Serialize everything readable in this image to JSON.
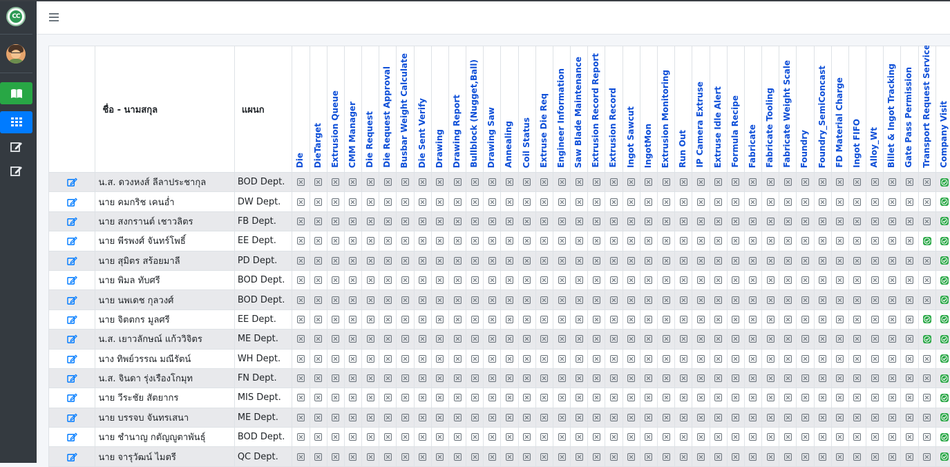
{
  "sidebar": {
    "logo_text": "CC",
    "icons": [
      "logo-icon",
      "user-avatar",
      "book-icon",
      "grid-icon",
      "edit-icon",
      "edit-icon"
    ],
    "accent_green": "#28a745",
    "accent_blue": "#007bff",
    "bg": "#343a40"
  },
  "header": {
    "menu_icon": "hamburger-icon"
  },
  "table": {
    "col_name": "ชื่อ - นามสกุล",
    "col_dept": "แผนก",
    "permission_columns": [
      "Die",
      "DieTarget",
      "Extrusion Queue",
      "CMM Manager",
      "Die Request",
      "Die Request Approval",
      "Busbar Weight Calculate",
      "Die Sent Verify",
      "Drawing",
      "Drawing Report",
      "Bullblock (Nugget,Ball)",
      "Drawing Saw",
      "Annealing",
      "Coil Status",
      "Extruse Die Req",
      "Engineer Information",
      "Saw Blade Maintenance",
      "Extrusion Record Report",
      "Extrusion Record",
      "Ingot Sawcut",
      "IngotMon",
      "Extrusion Monitoring",
      "Run Out",
      "IP Camera Extruse",
      "Extruse Idle Alert",
      "Formula Recipe",
      "Fabricate",
      "Fabricate Tooling",
      "Fabricate Weight Scale",
      "Foundry",
      "Foundry_SemiConcast",
      "FD Material Charge",
      "Ingot FIFO",
      "Alloy_Wt",
      "Billet & Ingot Tracking",
      "Gate Pass Permission",
      "Transport Request Service",
      "Company Visit"
    ],
    "rows": [
      {
        "name": "น.ส. ดวงหงส์   ลีลาประชากุล",
        "dept": "BOD Dept.",
        "granted": [
          37
        ]
      },
      {
        "name": "นาย คมกริช   เคนอ่ำ",
        "dept": "DW Dept.",
        "granted": [
          37
        ]
      },
      {
        "name": "นาย สงกรานต์   เชาวลิตร",
        "dept": "FB Dept.",
        "granted": [
          37
        ]
      },
      {
        "name": "นาย พีรพงศ์   จันทร์โพธิ์",
        "dept": "EE Dept.",
        "granted": [
          36,
          37
        ]
      },
      {
        "name": "นาย สุมิตร   สร้อยมาลี",
        "dept": "PD Dept.",
        "granted": [
          37
        ]
      },
      {
        "name": "นาย พิมล   ทับศรี",
        "dept": "BOD Dept.",
        "granted": [
          37
        ]
      },
      {
        "name": "นาย นพเดช   กุลวงศ์",
        "dept": "BOD Dept.",
        "granted": [
          37
        ]
      },
      {
        "name": "นาย จิตตกร   มูลศรี",
        "dept": "EE Dept.",
        "granted": [
          36,
          37
        ]
      },
      {
        "name": "น.ส. เยาวลักษณ์   แก้ววิจิตร",
        "dept": "ME Dept.",
        "granted": [
          36,
          37
        ]
      },
      {
        "name": "นาง ทิพย์วรรณ   มณีรัตน์",
        "dept": "WH Dept.",
        "granted": [
          37
        ]
      },
      {
        "name": "น.ส. จินดา   รุ่งเรืองโกมุท",
        "dept": "FN Dept.",
        "granted": [
          37
        ]
      },
      {
        "name": "นาย วีระชัย   สัตยากร",
        "dept": "MIS Dept.",
        "granted": [
          37
        ]
      },
      {
        "name": "นาย บรรจบ   จันทรเสนา",
        "dept": "ME Dept.",
        "granted": [
          37
        ]
      },
      {
        "name": "นาย ชำนาญ   กตัญญูตาพันธุ์",
        "dept": "BOD Dept.",
        "granted": [
          37
        ]
      },
      {
        "name": "นาย จารุวัฒน์   ไมตรี",
        "dept": "QC Dept.",
        "granted": [
          37
        ]
      }
    ],
    "row_edit_icon": "edit-icon",
    "denied_icon": "x-square-icon",
    "granted_icon": "check-circle-icon",
    "colors": {
      "header_link": "#0e4fd8",
      "granted": "#28a745",
      "denied": "#6c757d",
      "edit": "#007bff"
    }
  }
}
